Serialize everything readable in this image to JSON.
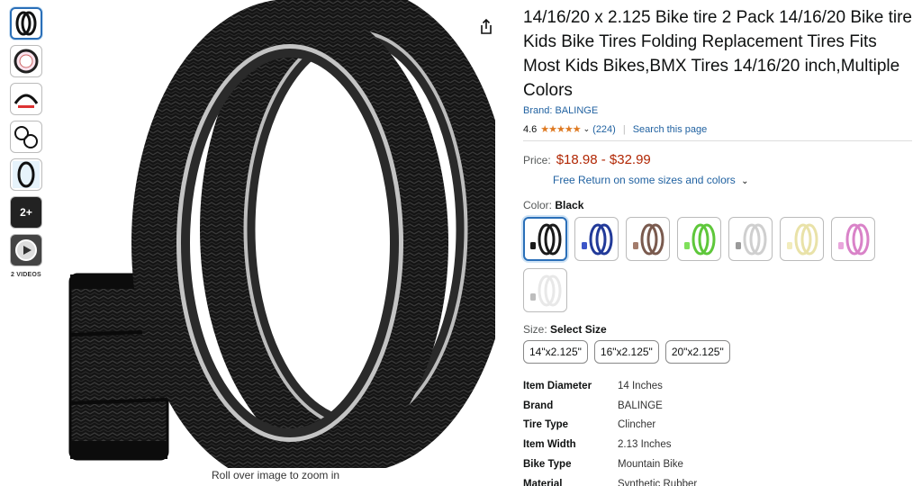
{
  "thumbnails": [
    {
      "name": "thumb-tires-black",
      "icon": "tire-pair-icon",
      "selected": true
    },
    {
      "name": "thumb-tire-detail",
      "icon": "tire-pink-icon"
    },
    {
      "name": "thumb-tire-specs",
      "icon": "tire-spec-icon"
    },
    {
      "name": "thumb-install",
      "icon": "install-icon"
    },
    {
      "name": "thumb-tire-side",
      "icon": "tire-side-icon"
    },
    {
      "name": "thumb-more",
      "icon": "more-images-icon",
      "label": "2+"
    },
    {
      "name": "thumb-video",
      "icon": "play-icon"
    }
  ],
  "videos_label": "2 VIDEOS",
  "zoom_hint": "Roll over image to zoom in",
  "product": {
    "title": "14/16/20 x 2.125 Bike tire 2 Pack 14/16/20 Bike tire Kids Bike Tires Folding Replacement Tires Fits Most Kids Bikes,BMX Tires 14/16/20 inch,Multiple Colors",
    "brand_link": "Brand: BALINGE",
    "rating": "4.6",
    "stars": "★★★★★",
    "review_count": "(224)",
    "search_page": "Search this page",
    "price_label": "Price:",
    "price": "$18.98 - $32.99",
    "free_return": "Free Return on some sizes and colors",
    "color_label": "Color:",
    "color_value": "Black",
    "size_label": "Size:",
    "size_value": "Select Size"
  },
  "colors": [
    {
      "name": "black",
      "tire": "#1a1a1a",
      "accent": "#1a1a1a"
    },
    {
      "name": "blue",
      "tire": "#223a99",
      "accent": "#3c55c8"
    },
    {
      "name": "brown",
      "tire": "#7a5a4e",
      "accent": "#a37c6c"
    },
    {
      "name": "green",
      "tire": "#5ec73a",
      "accent": "#7fe05a"
    },
    {
      "name": "white-grey",
      "tire": "#cfcfcf",
      "accent": "#9a9a9a"
    },
    {
      "name": "cream",
      "tire": "#e9e2a8",
      "accent": "#f2ecbc"
    },
    {
      "name": "pink",
      "tire": "#d982c8",
      "accent": "#e9a6dc"
    },
    {
      "name": "white",
      "tire": "#e8e8e8",
      "accent": "#bdbdbd"
    }
  ],
  "sizes": [
    "14\"x2.125\"",
    "16\"x2.125\"",
    "20\"x2.125\""
  ],
  "specs": [
    {
      "key": "Item Diameter",
      "value": "14 Inches"
    },
    {
      "key": "Brand",
      "value": "BALINGE"
    },
    {
      "key": "Tire Type",
      "value": "Clincher"
    },
    {
      "key": "Item Width",
      "value": "2.13 Inches"
    },
    {
      "key": "Bike Type",
      "value": "Mountain Bike"
    },
    {
      "key": "Material",
      "value": "Synthetic Rubber"
    }
  ],
  "colors_accent": {
    "link": "#2162a1",
    "price": "#b12704",
    "star": "#de7921",
    "selected_border": "#2a6fb8"
  }
}
